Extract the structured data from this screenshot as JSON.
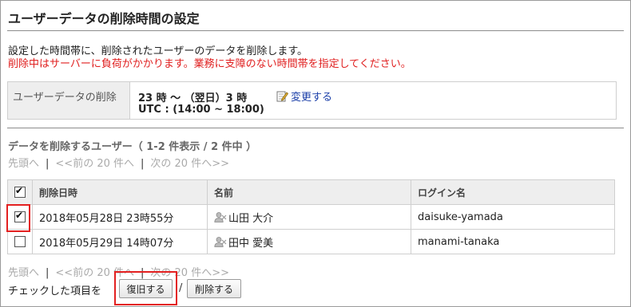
{
  "page": {
    "title": "ユーザーデータの削除時間の設定"
  },
  "description": {
    "line1": "設定した時間帯に、削除されたユーザーのデータを削除します。",
    "line2": "削除中はサーバーに負荷がかかります。業務に支障のない時間帯を指定してください。"
  },
  "setting": {
    "label": "ユーザーデータの削除",
    "value_line1": "23 時 ～ （翌日）3 時",
    "value_line2": "UTC : (14:00 ~ 18:00)",
    "edit_link": "変更する"
  },
  "section": {
    "title": "データを削除するユーザー（ 1-2 件表示 / 2 件中 ）"
  },
  "pager": {
    "first": "先頭へ",
    "prev": "<<前の 20 件へ",
    "next": "次の 20 件へ>>",
    "separator": "|"
  },
  "table": {
    "headers": {
      "date": "削除日時",
      "name": "名前",
      "login": "ログイン名"
    },
    "rows": [
      {
        "checked": true,
        "date": "2018年05月28日 23時55分",
        "name": "山田 大介",
        "login": "daisuke-yamada"
      },
      {
        "checked": false,
        "date": "2018年05月29日 14時07分",
        "name": "田中 愛美",
        "login": "manami-tanaka"
      }
    ]
  },
  "actions": {
    "label": "チェックした項目を",
    "restore_button": "復旧する",
    "separator": "/",
    "delete_button": "削除する"
  },
  "colors": {
    "warning": "#e02020",
    "link": "#1a3ea8",
    "highlight": "#e32020"
  }
}
